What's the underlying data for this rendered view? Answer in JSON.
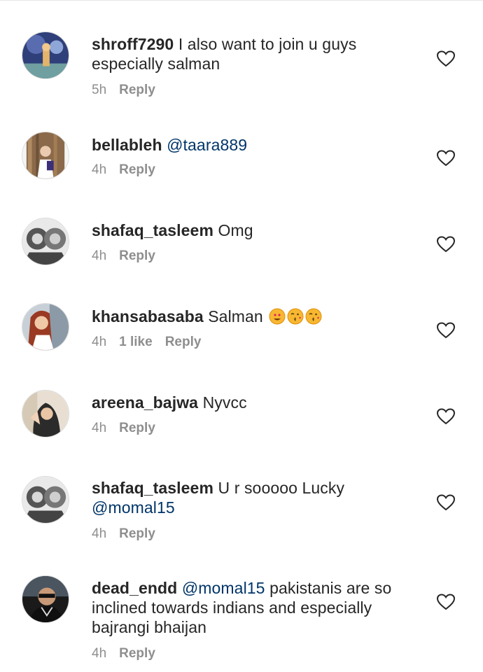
{
  "comments": [
    {
      "username": "shroff7290",
      "text": "I also want to join u guys especially salman",
      "mention": "",
      "time": "5h",
      "likes": "",
      "reply": "Reply"
    },
    {
      "username": "bellableh",
      "text": "",
      "mention": "@taara889",
      "time": "4h",
      "likes": "",
      "reply": "Reply"
    },
    {
      "username": "shafaq_tasleem",
      "text": "Omg",
      "mention": "",
      "time": "4h",
      "likes": "",
      "reply": "Reply"
    },
    {
      "username": "khansabasaba",
      "text": "Salman",
      "mention": "",
      "emojis": [
        "heart-eyes-emoji",
        "kiss-emoji",
        "kiss-emoji"
      ],
      "time": "4h",
      "likes": "1 like",
      "reply": "Reply"
    },
    {
      "username": "areena_bajwa",
      "text": "Nyvcc",
      "mention": "",
      "time": "4h",
      "likes": "",
      "reply": "Reply"
    },
    {
      "username": "shafaq_tasleem",
      "text": "U r sooooo Lucky",
      "mention": "@momal15",
      "time": "4h",
      "likes": "",
      "reply": "Reply"
    },
    {
      "username": "dead_endd",
      "text": "pakistanis are so inclined towards indians and especially bajrangi bhaijan",
      "mention": "@momal15",
      "time": "4h",
      "likes": "",
      "reply": "Reply"
    }
  ],
  "icons": {
    "like": "heart-outline-icon"
  },
  "colors": {
    "text": "#262626",
    "meta": "#8e8e8e",
    "mention": "#003569",
    "heart": "#262626"
  }
}
